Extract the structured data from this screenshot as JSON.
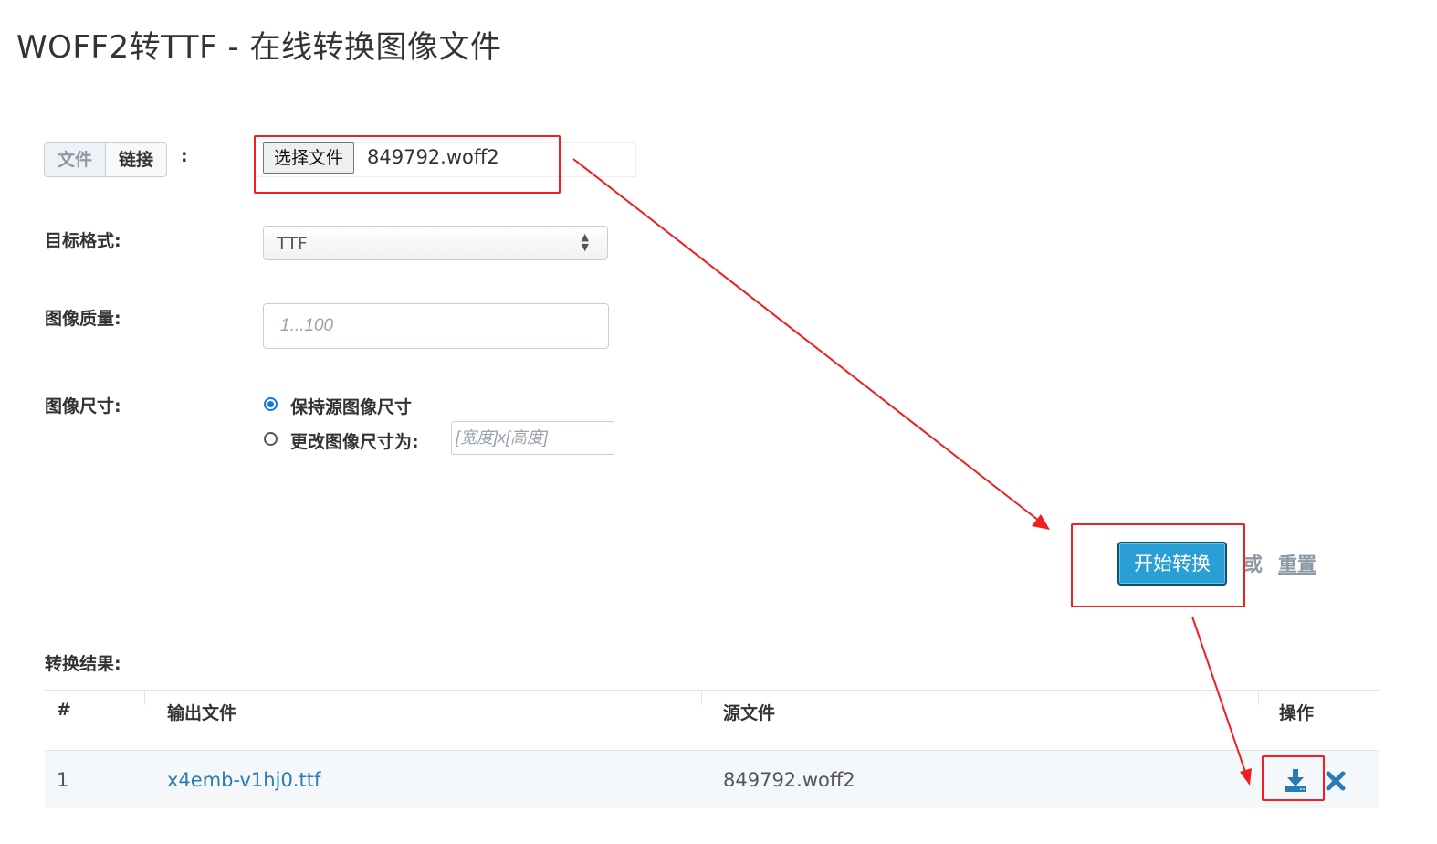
{
  "page": {
    "title": "WOFF2转TTF - 在线转换图像文件"
  },
  "source": {
    "tabs": [
      {
        "label": "文件",
        "active": true
      },
      {
        "label": "链接",
        "active": false
      }
    ],
    "colon": ":",
    "choose_file_label": "选择文件",
    "selected_file": "849792.woff2"
  },
  "target_format": {
    "label": "目标格式:",
    "value": "TTF"
  },
  "quality": {
    "label": "图像质量:",
    "placeholder": "1...100"
  },
  "size": {
    "label": "图像尺寸:",
    "options": [
      {
        "label": "保持源图像尺寸",
        "checked": true
      },
      {
        "label": "更改图像尺寸为:",
        "checked": false
      }
    ],
    "custom_placeholder": "[宽度]x[高度]"
  },
  "actions": {
    "start_label": "开始转换",
    "or_text": "或",
    "reset_label": "重置"
  },
  "results": {
    "label": "转换结果:",
    "headers": [
      "#",
      "输出文件",
      "源文件",
      "操作"
    ],
    "rows": [
      {
        "index": "1",
        "output_file": "x4emb-v1hj0.ttf",
        "source_file": "849792.woff2"
      }
    ]
  },
  "colors": {
    "primary_button": "#2a9fd6",
    "link": "#2a7ab8",
    "annotation_red": "#f02020"
  }
}
